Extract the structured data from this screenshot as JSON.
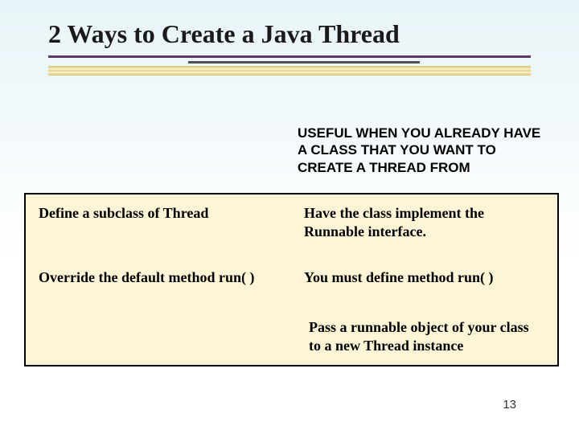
{
  "title": "2 Ways to Create a Java Thread",
  "callout": "USEFUL WHEN YOU ALREADY HAVE A CLASS THAT YOU WANT TO CREATE A THREAD FROM",
  "table": {
    "r1c1": "Define a subclass of Thread",
    "r1c2": "Have the class implement the Runnable interface.",
    "r2c1": "Override the default method run( )",
    "r2c2": "You must define method run( )",
    "r3": "Pass a runnable object of your class to a new Thread instance"
  },
  "page_number": "13"
}
